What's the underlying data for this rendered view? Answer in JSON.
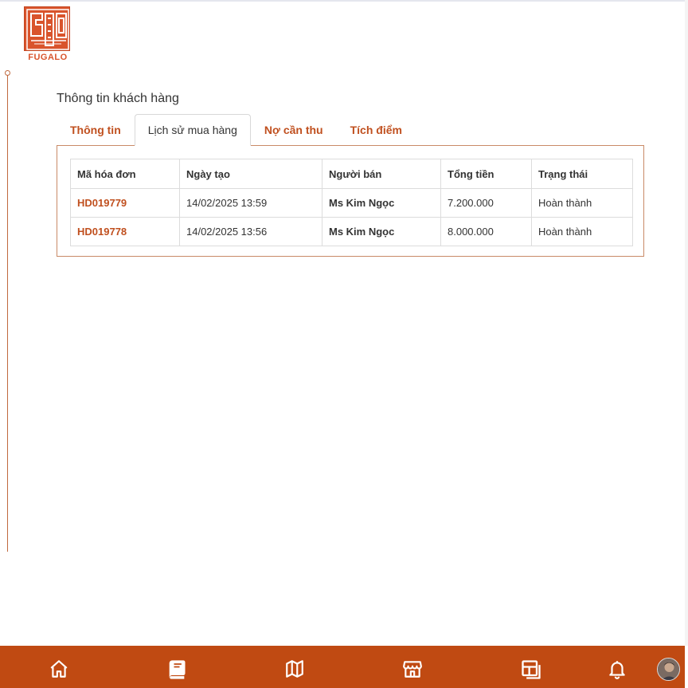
{
  "brand": {
    "logo_text": "FUGALO",
    "accent": "#c04a12"
  },
  "panel": {
    "title": "Thông tin khách hàng"
  },
  "tabs": [
    {
      "label": "Thông tin",
      "active": false
    },
    {
      "label": "Lịch sử mua hàng",
      "active": true
    },
    {
      "label": "Nợ cần thu",
      "active": false
    },
    {
      "label": "Tích điểm",
      "active": false
    }
  ],
  "table": {
    "headers": [
      "Mã hóa đơn",
      "Ngày tạo",
      "Người bán",
      "Tổng tiền",
      "Trạng thái"
    ],
    "rows": [
      {
        "code": "HD019779",
        "date": "14/02/2025 13:59",
        "seller": "Ms Kim Ngọc",
        "total": "7.200.000",
        "status": "Hoàn thành"
      },
      {
        "code": "HD019778",
        "date": "14/02/2025 13:56",
        "seller": "Ms Kim Ngọc",
        "total": "8.000.000",
        "status": "Hoàn thành"
      }
    ]
  },
  "bottom_nav": {
    "icons": [
      "home-icon",
      "book-icon",
      "map-icon",
      "store-icon",
      "layout-icon",
      "bell-icon",
      "user-avatar"
    ]
  }
}
